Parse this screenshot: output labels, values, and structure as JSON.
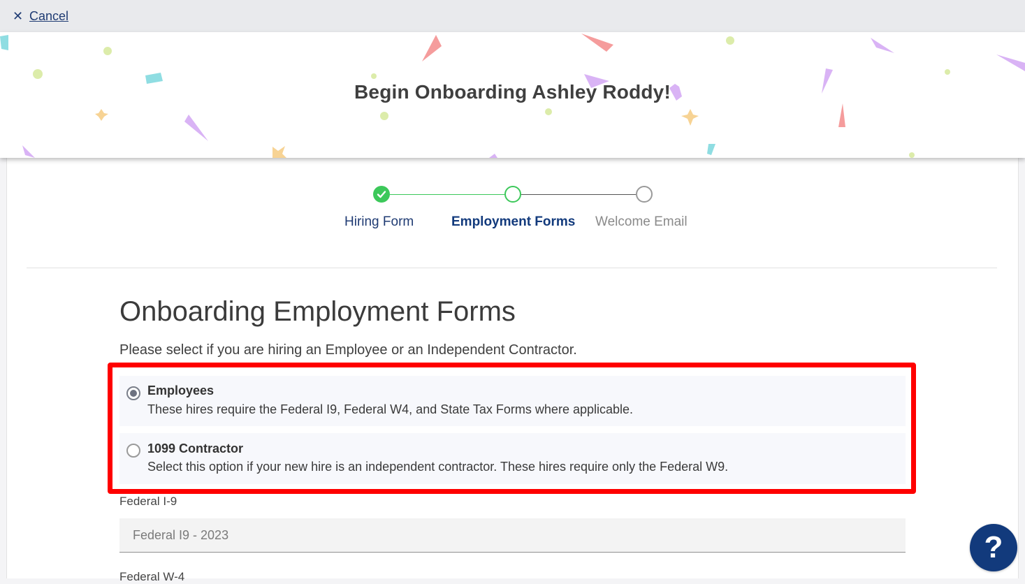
{
  "topbar": {
    "cancel_label": "Cancel",
    "cancel_icon": "close-icon"
  },
  "banner": {
    "title": "Begin Onboarding Ashley Roddy!"
  },
  "stepper": {
    "steps": [
      {
        "label": "Hiring Form",
        "state": "complete"
      },
      {
        "label": "Employment Forms",
        "state": "current"
      },
      {
        "label": "Welcome Email",
        "state": "upcoming"
      }
    ]
  },
  "main": {
    "heading": "Onboarding Employment Forms",
    "instruction": "Please select if you are hiring an Employee or an Independent Contractor.",
    "options": [
      {
        "title": "Employees",
        "description": "These hires require the Federal I9, Federal W4, and State Tax Forms where applicable.",
        "selected": true
      },
      {
        "title": "1099 Contractor",
        "description": "Select this option if your new hire is an independent contractor. These hires require only the Federal W9.",
        "selected": false
      }
    ],
    "fields": [
      {
        "label": "Federal I-9",
        "value": "Federal I9 - 2023"
      },
      {
        "label": "Federal W-4"
      }
    ]
  },
  "help": {
    "label": "?"
  },
  "colors": {
    "accent": "#123a7c",
    "complete_green": "#3cc85a",
    "highlight_red": "#ff0000",
    "topbar_bg": "#e9eaed"
  }
}
